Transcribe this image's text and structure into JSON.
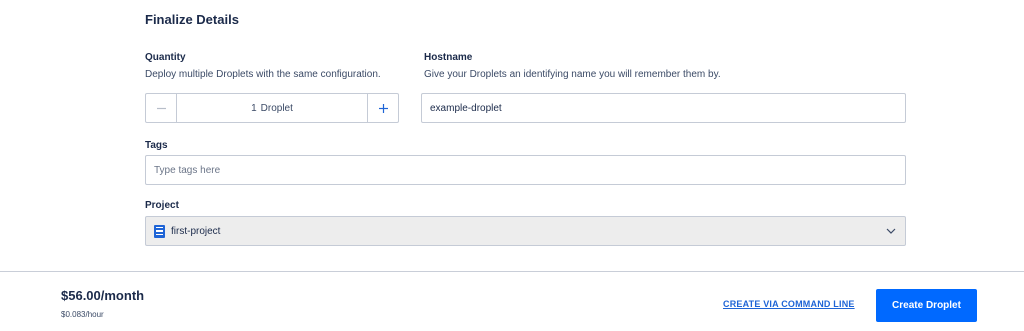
{
  "section": {
    "title": "Finalize Details"
  },
  "quantity": {
    "label": "Quantity",
    "help": "Deploy multiple Droplets with the same configuration.",
    "value": "1",
    "unit": "Droplet",
    "minus_icon": "minus-icon",
    "plus_icon": "plus-icon"
  },
  "hostname": {
    "label": "Hostname",
    "help": "Give your Droplets an identifying name you will remember them by.",
    "value": "example-droplet"
  },
  "tags": {
    "label": "Tags",
    "placeholder": "Type tags here"
  },
  "project": {
    "label": "Project",
    "selected": "first-project",
    "icon": "project-icon"
  },
  "footer": {
    "price": "$56.00/month",
    "price_hour": "$0.083/hour",
    "cli_link": "CREATE VIA COMMAND LINE",
    "create_button": "Create Droplet"
  },
  "colors": {
    "accent": "#0069ff",
    "link": "#1e64d6",
    "text": "#1b2a4a"
  }
}
